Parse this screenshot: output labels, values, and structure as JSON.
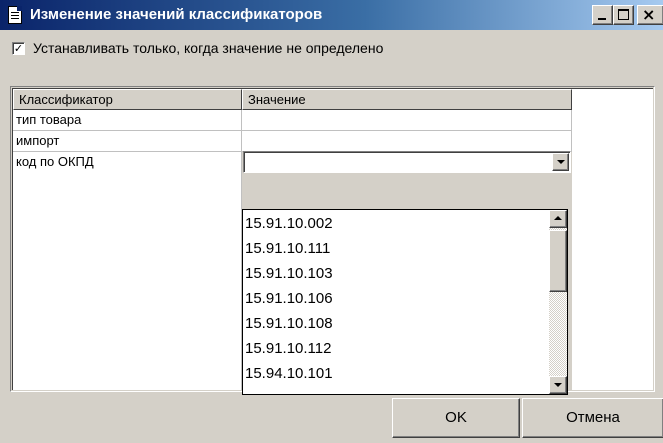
{
  "window": {
    "title": "Изменение значений классификаторов",
    "controls": [
      "minimize",
      "maximize",
      "close"
    ]
  },
  "options": {
    "only_when_undefined": {
      "label": "Устанавливать только, когда значение не определено",
      "checked": true,
      "mark": "✓"
    }
  },
  "grid": {
    "columns": [
      "Классификатор",
      "Значение"
    ],
    "rows": [
      {
        "classifier": "тип товара",
        "value": ""
      },
      {
        "classifier": "импорт",
        "value": ""
      },
      {
        "classifier": "код по ОКПД",
        "value": ""
      }
    ]
  },
  "dropdown": {
    "items": [
      "15.91.10.002",
      "15.91.10.111",
      "15.91.10.103",
      "15.91.10.106",
      "15.91.10.108",
      "15.91.10.112",
      "15.94.10.101"
    ]
  },
  "buttons": {
    "ok": "OK",
    "cancel": "Отмена"
  },
  "colors": {
    "titlebar_start": "#0a246a",
    "titlebar_end": "#a6caf0",
    "face": "#d4d0c8"
  }
}
